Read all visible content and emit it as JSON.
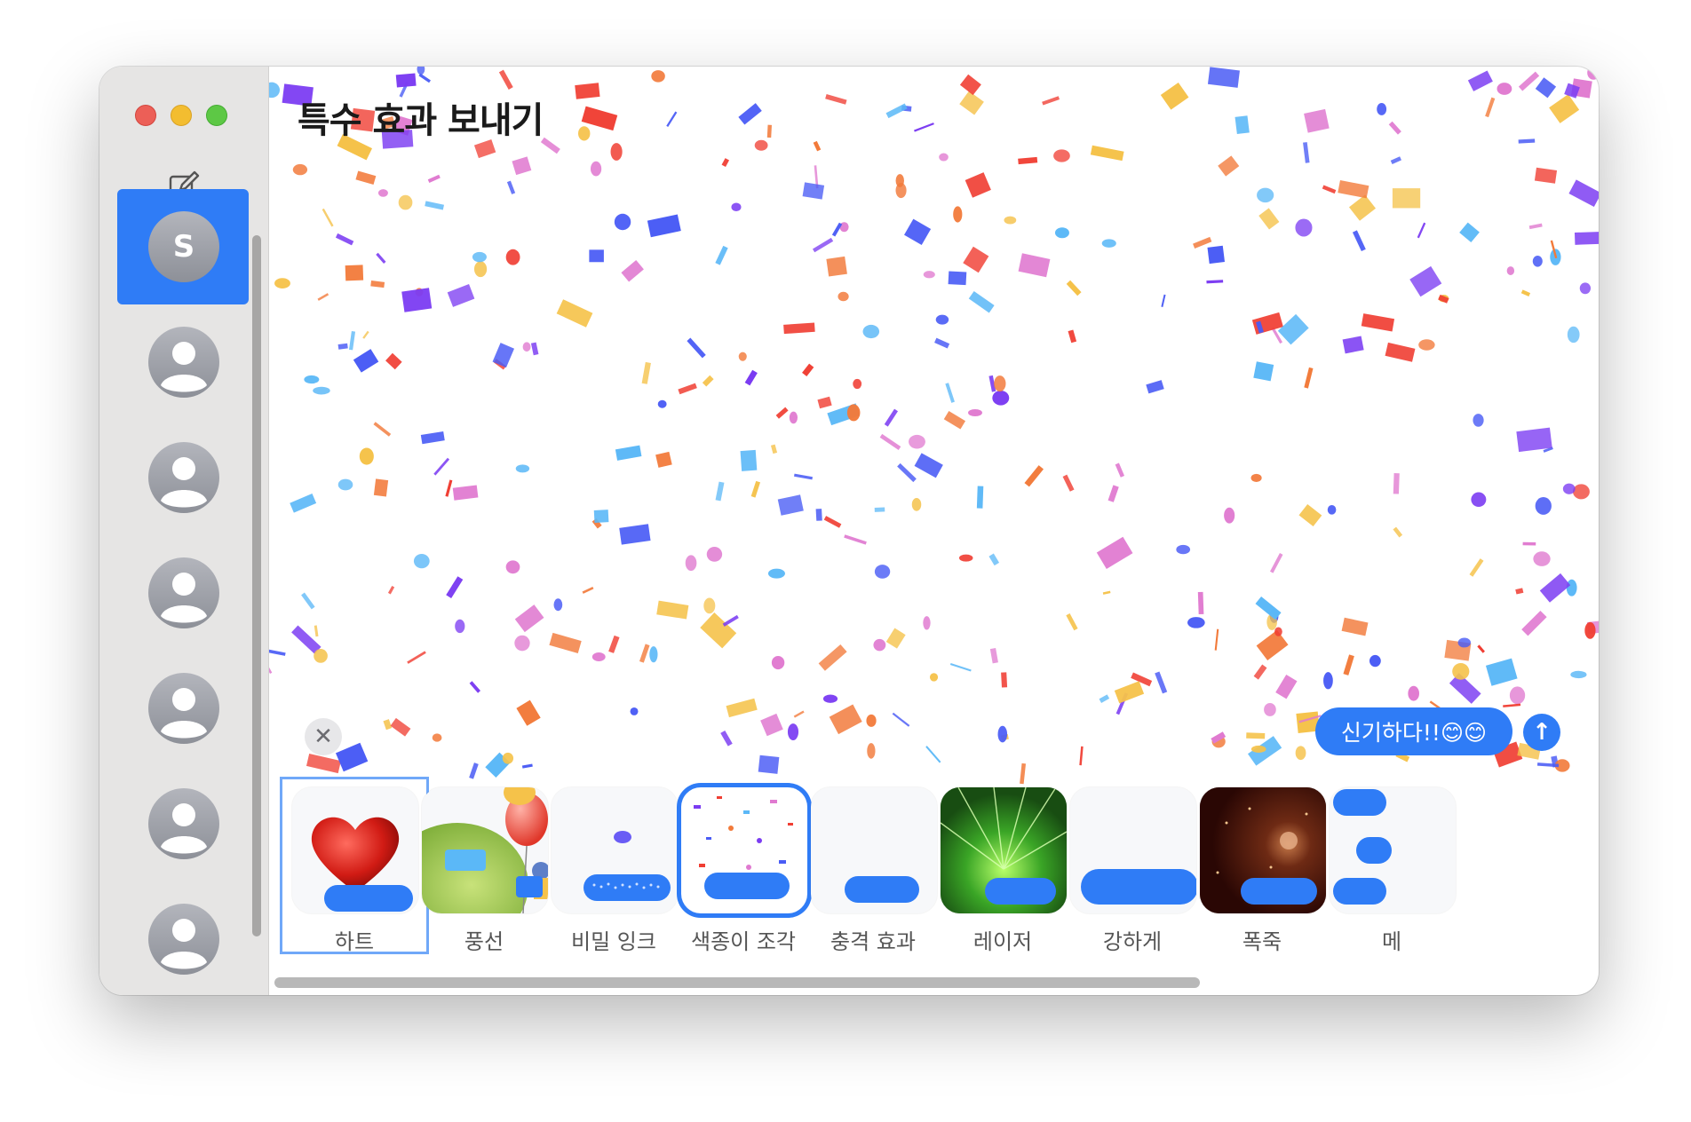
{
  "window": {
    "title": "특수 효과 보내기"
  },
  "sidebar": {
    "selected_conversation": {
      "initial": "S"
    },
    "conversation_count": 7
  },
  "composer": {
    "message_text": "신기하다!!😊😊",
    "close_label": "✕",
    "send_label": "↑"
  },
  "effects": [
    {
      "label": "하트",
      "icon": "heart"
    },
    {
      "label": "풍선",
      "icon": "balloons"
    },
    {
      "label": "비밀 잉크",
      "icon": "invisible-ink"
    },
    {
      "label": "색종이 조각",
      "icon": "confetti"
    },
    {
      "label": "충격 효과",
      "icon": "echo"
    },
    {
      "label": "레이저",
      "icon": "lasers"
    },
    {
      "label": "강하게",
      "icon": "loud"
    },
    {
      "label": "폭죽",
      "icon": "fireworks"
    },
    {
      "label": "메",
      "icon": "echo-partial"
    }
  ],
  "colors": {
    "accent": "#2f7cf6",
    "sidebar_bg": "#e6e5e4",
    "confetti": [
      "#7b3cf2",
      "#f03e33",
      "#5bb8f7",
      "#f5c24a",
      "#e07ad0",
      "#4a5cf5",
      "#f27a3a"
    ]
  }
}
